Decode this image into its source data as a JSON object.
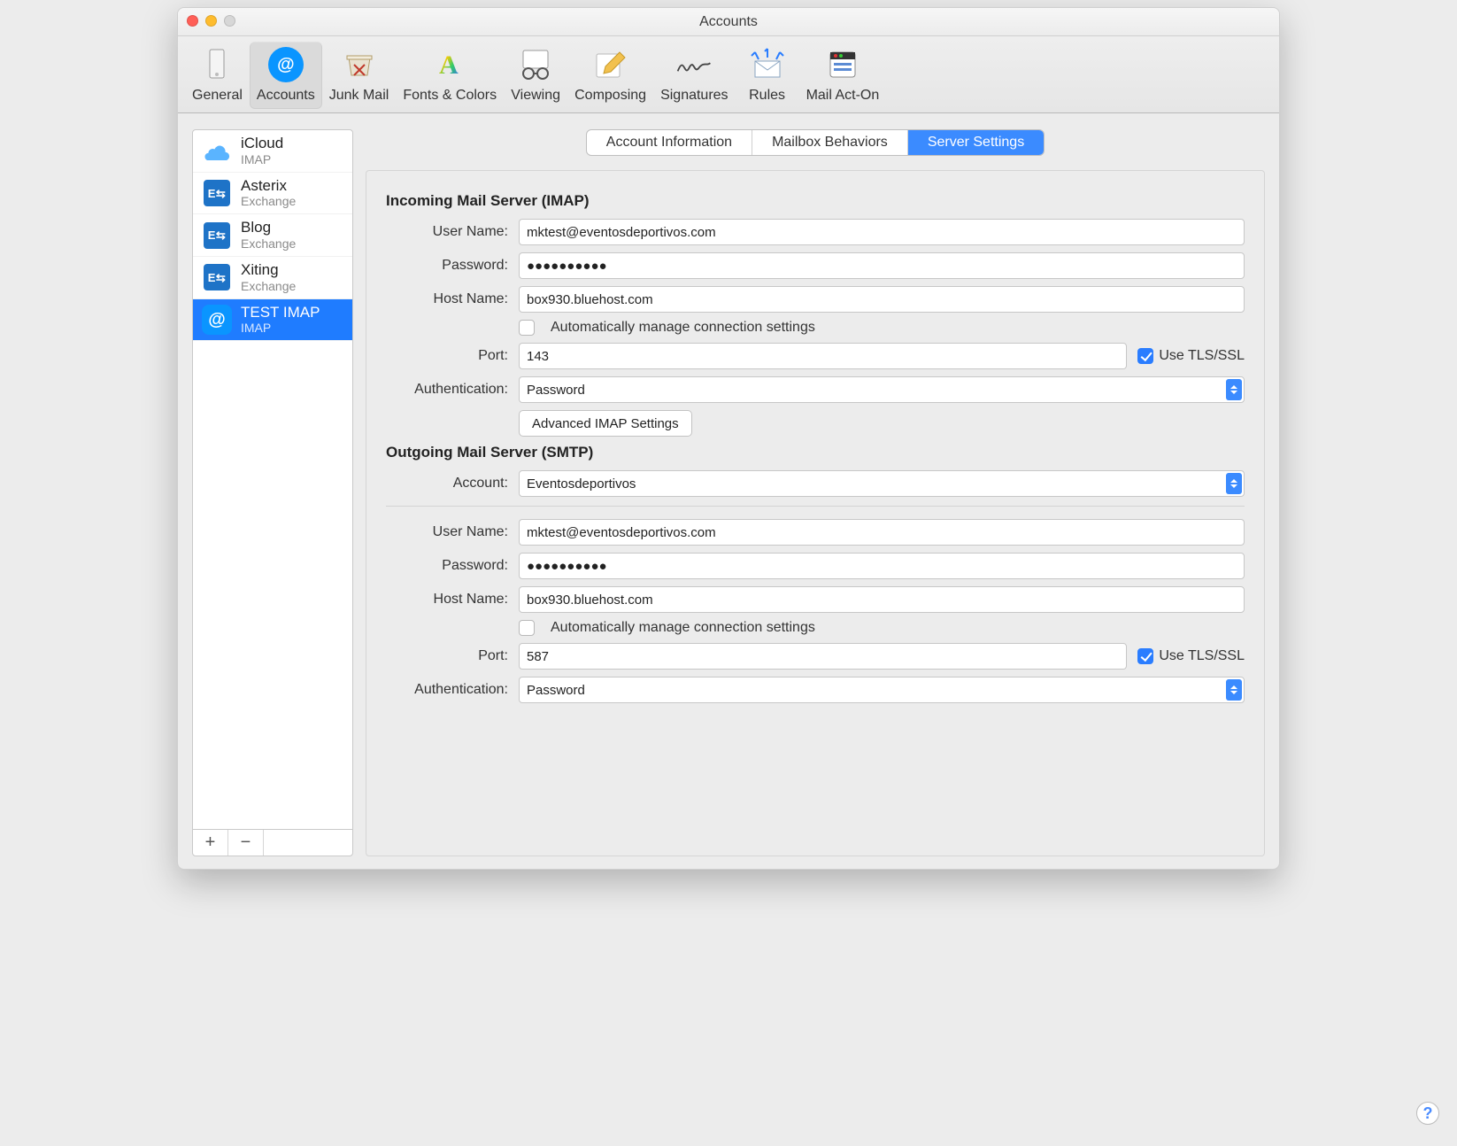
{
  "window": {
    "title": "Accounts"
  },
  "toolbar": {
    "items": [
      {
        "label": "General"
      },
      {
        "label": "Accounts"
      },
      {
        "label": "Junk Mail"
      },
      {
        "label": "Fonts & Colors"
      },
      {
        "label": "Viewing"
      },
      {
        "label": "Composing"
      },
      {
        "label": "Signatures"
      },
      {
        "label": "Rules"
      },
      {
        "label": "Mail Act-On"
      }
    ]
  },
  "sidebar": {
    "accounts": [
      {
        "name": "iCloud",
        "protocol": "IMAP",
        "icon": "cloud"
      },
      {
        "name": "Asterix",
        "protocol": "Exchange",
        "icon": "exchange"
      },
      {
        "name": "Blog",
        "protocol": "Exchange",
        "icon": "exchange"
      },
      {
        "name": "Xiting",
        "protocol": "Exchange",
        "icon": "exchange"
      },
      {
        "name": "TEST IMAP",
        "protocol": "IMAP",
        "icon": "at"
      }
    ],
    "plus": "+",
    "minus": "−"
  },
  "tabs": {
    "items": [
      "Account Information",
      "Mailbox Behaviors",
      "Server Settings"
    ],
    "active_index": 2
  },
  "server_settings": {
    "incoming": {
      "section_title": "Incoming Mail Server (IMAP)",
      "labels": {
        "user_name": "User Name:",
        "password": "Password:",
        "host_name": "Host Name:",
        "auto_manage": "Automatically manage connection settings",
        "port": "Port:",
        "use_tls": "Use TLS/SSL",
        "authentication": "Authentication:",
        "advanced_btn": "Advanced IMAP Settings"
      },
      "values": {
        "user_name": "mktest@eventosdeportivos.com",
        "password_mask": "●●●●●●●●●●",
        "host_name": "box930.bluehost.com",
        "auto_manage_checked": false,
        "port": "143",
        "use_tls_checked": true,
        "authentication": "Password"
      }
    },
    "outgoing": {
      "section_title": "Outgoing Mail Server (SMTP)",
      "labels": {
        "account": "Account:",
        "user_name": "User Name:",
        "password": "Password:",
        "host_name": "Host Name:",
        "auto_manage": "Automatically manage connection settings",
        "port": "Port:",
        "use_tls": "Use TLS/SSL",
        "authentication": "Authentication:"
      },
      "values": {
        "account": "Eventosdeportivos",
        "user_name": "mktest@eventosdeportivos.com",
        "password_mask": "●●●●●●●●●●",
        "host_name": "box930.bluehost.com",
        "auto_manage_checked": false,
        "port": "587",
        "use_tls_checked": true,
        "authentication": "Password"
      }
    }
  },
  "help_glyph": "?"
}
